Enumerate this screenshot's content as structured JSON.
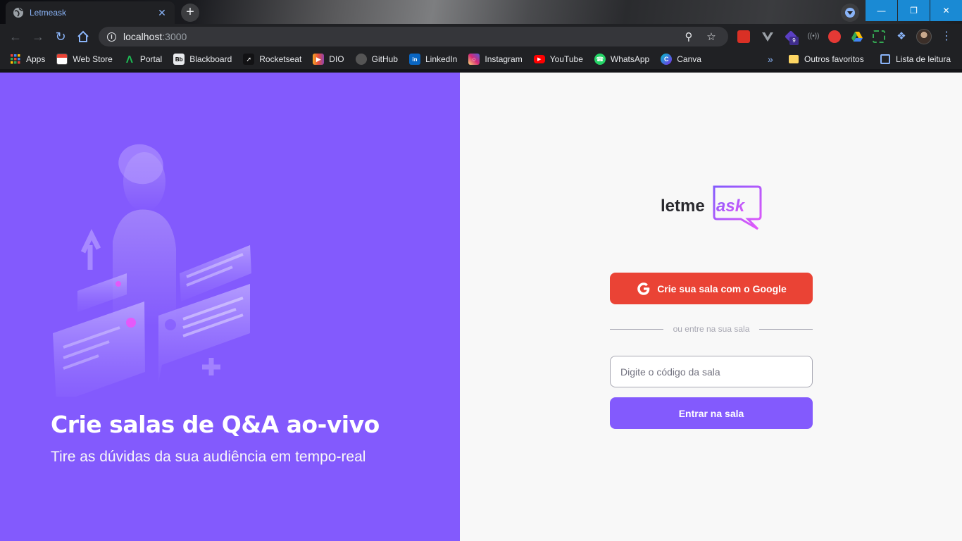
{
  "browser": {
    "tab_title": "Letmeask",
    "tab_close": "✕",
    "new_tab": "+",
    "url_host": "localhost",
    "url_port": ":3000",
    "extension_badge": "9",
    "bookmarks": [
      {
        "label": "Apps",
        "icon": "apps-grid-icon",
        "color": "#4285f4"
      },
      {
        "label": "Web Store",
        "icon": "web-store-icon",
        "color": "#e8eaed"
      },
      {
        "label": "Portal",
        "icon": "portal-icon",
        "color": "#1db954"
      },
      {
        "label": "Blackboard",
        "icon": "blackboard-icon",
        "color": "#e8eaed"
      },
      {
        "label": "Rocketseat",
        "icon": "rocketseat-icon",
        "color": "#121214"
      },
      {
        "label": "DIO",
        "icon": "dio-icon",
        "color": "#e84e3c"
      },
      {
        "label": "GitHub",
        "icon": "github-icon",
        "color": "#555555"
      },
      {
        "label": "LinkedIn",
        "icon": "linkedin-icon",
        "color": "#0a66c2"
      },
      {
        "label": "Instagram",
        "icon": "instagram-icon",
        "color": "#d62976"
      },
      {
        "label": "YouTube",
        "icon": "youtube-icon",
        "color": "#ff0000"
      },
      {
        "label": "WhatsApp",
        "icon": "whatsapp-icon",
        "color": "#25d366"
      },
      {
        "label": "Canva",
        "icon": "canva-icon",
        "color": "#7d2ae8"
      }
    ],
    "more_bookmarks": "»",
    "other_favorites": "Outros favoritos",
    "reading_list": "Lista de leitura"
  },
  "aside": {
    "title": "Crie salas de Q&A ao-vivo",
    "subtitle": "Tire as dúvidas da sua audiência em tempo-real"
  },
  "main": {
    "logo_text_1": "letme",
    "logo_text_2": "ask",
    "google_button_label": "Crie sua sala com o Google",
    "separator_text": "ou entre na sua sala",
    "room_input_placeholder": "Digite o código da sala",
    "room_input_value": "",
    "enter_button_label": "Entrar na sala"
  },
  "colors": {
    "brand_purple": "#835afd",
    "google_red": "#ea4335",
    "background": "#f8f8f8",
    "logo_pink": "#e559f9"
  }
}
